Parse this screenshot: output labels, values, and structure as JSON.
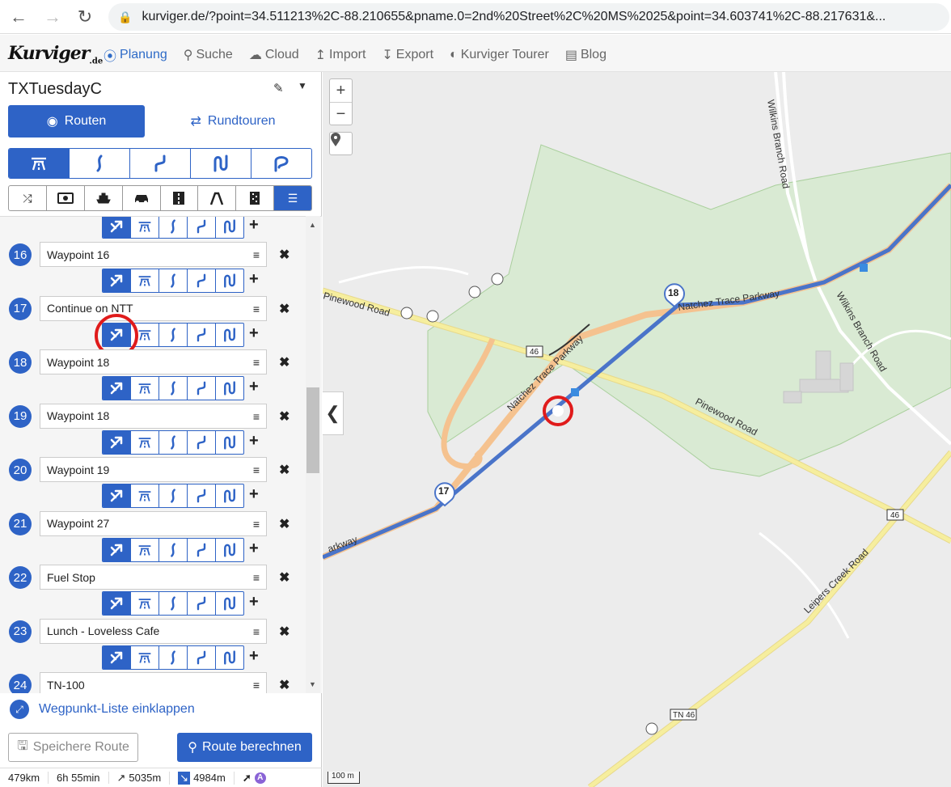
{
  "browser": {
    "url": "kurviger.de/?point=34.511213%2C-88.210655&pname.0=2nd%20Street%2C%20MS%2025&point=34.603741%2C-88.217631&..."
  },
  "app": {
    "logo": "Kurviger",
    "logo_suffix": ".de",
    "menu": {
      "planung": "Planung",
      "suche": "Suche",
      "cloud": "Cloud",
      "import": "Import",
      "export": "Export",
      "tourer": "Kurviger Tourer",
      "blog": "Blog"
    }
  },
  "sidebar": {
    "route_name": "TXTuesdayC",
    "tab_routen": "Routen",
    "tab_rundtouren": "Rundtouren",
    "waypoints": [
      {
        "num": "16",
        "label": "Waypoint 16"
      },
      {
        "num": "17",
        "label": "Continue on NTT"
      },
      {
        "num": "18",
        "label": "Waypoint 18"
      },
      {
        "num": "19",
        "label": "Waypoint 18"
      },
      {
        "num": "20",
        "label": "Waypoint 19"
      },
      {
        "num": "21",
        "label": "Waypoint 27"
      },
      {
        "num": "22",
        "label": "Fuel Stop"
      },
      {
        "num": "23",
        "label": "Lunch - Loveless Cafe"
      },
      {
        "num": "24",
        "label": "TN-100"
      }
    ],
    "collapse_label": "Wegpunkt-Liste einklappen",
    "save_label": "Speichere Route",
    "calc_label": "Route berechnen",
    "stats": {
      "distance": "479km",
      "duration": "6h 55min",
      "ascent": "5035m",
      "descent": "4984m"
    }
  },
  "map": {
    "scale": "100 m",
    "road_labels": {
      "natchez1": "Natchez Trace Parkway",
      "natchez2": "Natchez Trace Parkway",
      "pinewood1": "Pinewood Road",
      "pinewood2": "Pinewood Road",
      "wilkins1": "Wilkins Branch Road",
      "wilkins2": "Wilkins Branch Road",
      "leipers": "Leipers Creek Road",
      "parkway_frag": "arkway",
      "shield46a": "46",
      "shield46b": "46",
      "shield_tn46": "TN 46"
    },
    "markers": {
      "m17": "17",
      "m18": "18"
    }
  }
}
